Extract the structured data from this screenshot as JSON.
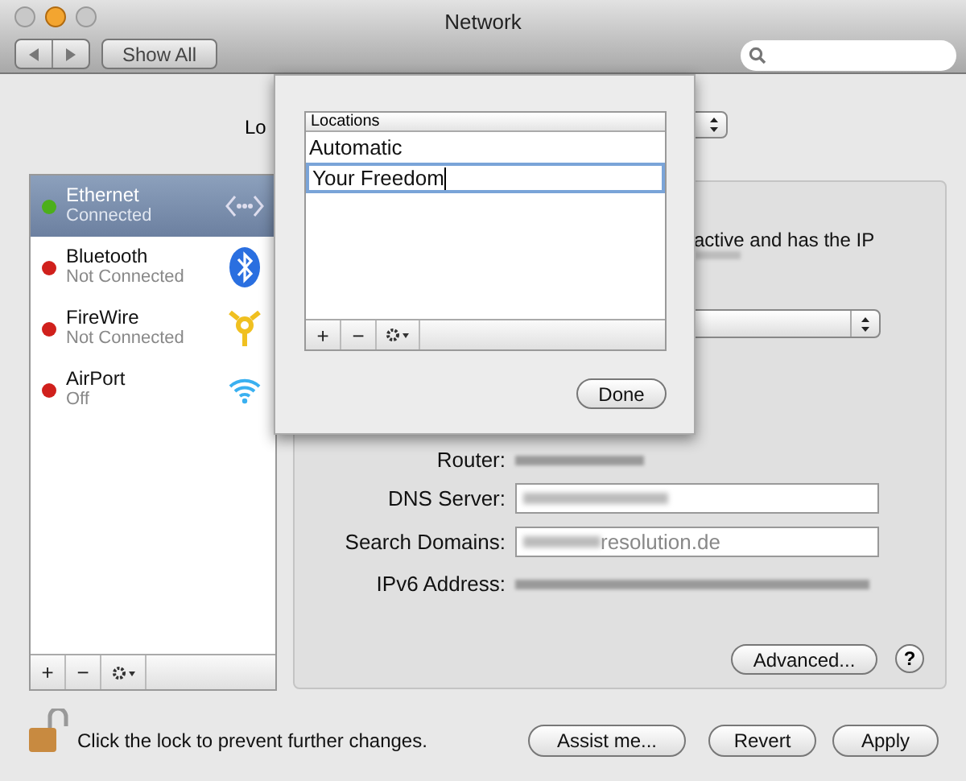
{
  "window": {
    "title": "Network"
  },
  "toolbar": {
    "show_all": "Show All"
  },
  "location_label": "Lo",
  "services": [
    {
      "name": "Ethernet",
      "status": "Connected",
      "selected": true,
      "color": "#4caf1a",
      "kind": "ethernet"
    },
    {
      "name": "Bluetooth",
      "status": "Not Connected",
      "selected": false,
      "color": "#d0201c",
      "kind": "bluetooth"
    },
    {
      "name": "FireWire",
      "status": "Not Connected",
      "selected": false,
      "color": "#d0201c",
      "kind": "firewire"
    },
    {
      "name": "AirPort",
      "status": "Off",
      "selected": false,
      "color": "#d0201c",
      "kind": "wifi"
    }
  ],
  "status_text": "active and has the IP",
  "fields": [
    {
      "label": "Router:",
      "kind": "text"
    },
    {
      "label": "DNS Server:",
      "kind": "field"
    },
    {
      "label": "Search Domains:",
      "kind": "field",
      "value": "resolution.de"
    },
    {
      "label": "IPv6 Address:",
      "kind": "text"
    }
  ],
  "advanced_button": "Advanced...",
  "help_button": "?",
  "list_buttons": [
    "+",
    "−"
  ],
  "lock_text": "Click the lock to prevent further changes.",
  "buttons": [
    "Assist me...",
    "Revert",
    "Apply"
  ],
  "sheet": {
    "header": "Locations",
    "items": [
      {
        "name": "Automatic",
        "selected": false
      },
      {
        "name": "Your Freedom",
        "selected": true
      }
    ],
    "buttons": [
      "+",
      "−"
    ],
    "done": "Done"
  }
}
